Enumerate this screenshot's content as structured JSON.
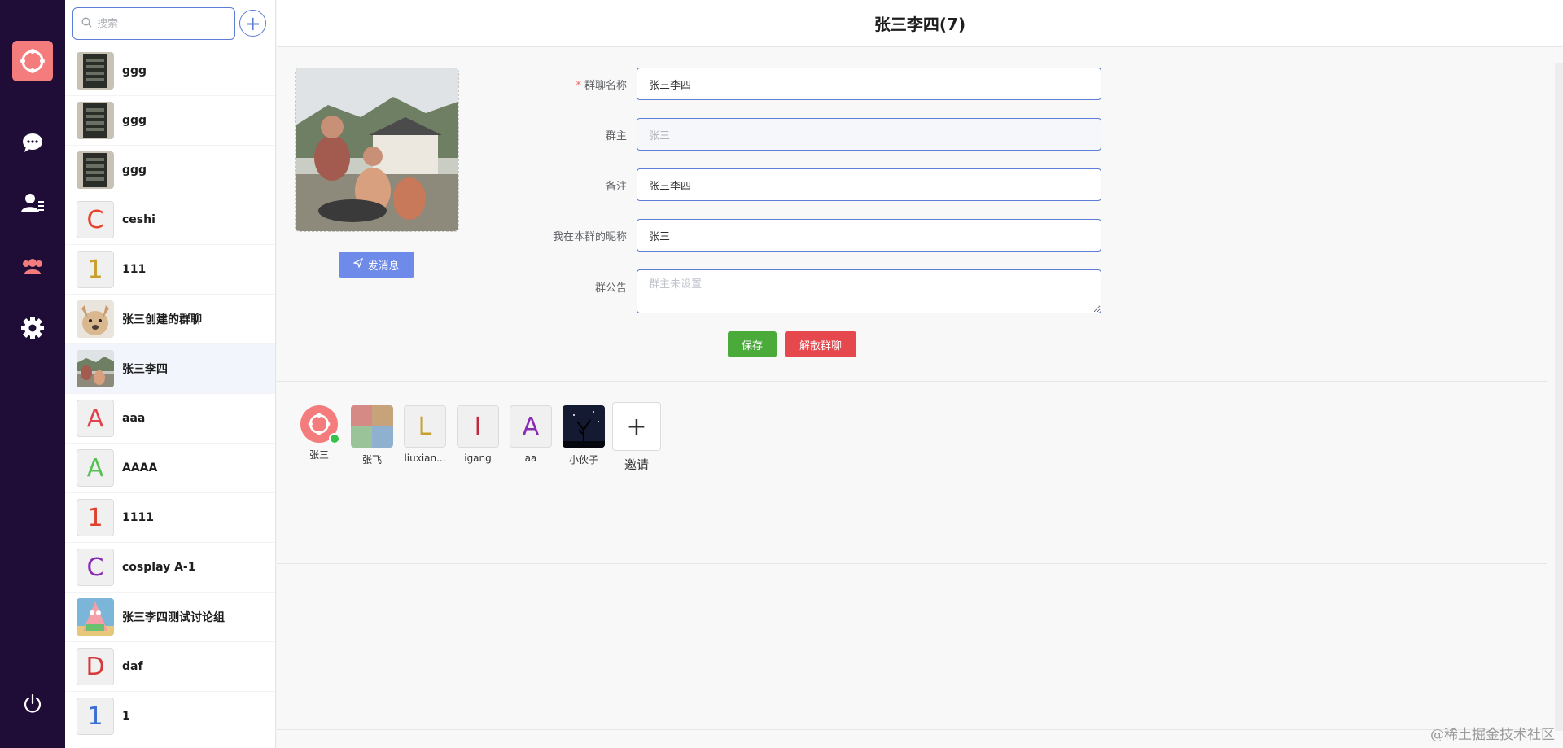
{
  "nav": {
    "logo_icon": "app-logo-icon",
    "items": [
      {
        "name": "chat-icon"
      },
      {
        "name": "contacts-icon"
      },
      {
        "name": "group-icon"
      },
      {
        "name": "settings-icon"
      }
    ],
    "logout_icon": "power-icon",
    "colors": {
      "background": "#1f0d37",
      "logo": "#f47c7c",
      "active": "#f47c7c"
    }
  },
  "search": {
    "placeholder": "搜索"
  },
  "list": {
    "items": [
      {
        "name": "ggg",
        "avatar": "image",
        "letter": ""
      },
      {
        "name": "ggg",
        "avatar": "image",
        "letter": ""
      },
      {
        "name": "ggg",
        "avatar": "image",
        "letter": ""
      },
      {
        "name": "ceshi",
        "avatar": "letter",
        "letter": "C",
        "color": "#e8412c"
      },
      {
        "name": "111",
        "avatar": "letter",
        "letter": "1",
        "color": "#c8a12b"
      },
      {
        "name": "张三创建的群聊",
        "avatar": "image",
        "letter": ""
      },
      {
        "name": "张三李四",
        "avatar": "image",
        "letter": "",
        "active": true
      },
      {
        "name": "aaa",
        "avatar": "letter",
        "letter": "A",
        "color": "#e0424b"
      },
      {
        "name": "AAAA",
        "avatar": "letter",
        "letter": "A",
        "color": "#54c251"
      },
      {
        "name": "1111",
        "avatar": "letter",
        "letter": "1",
        "color": "#e0412c"
      },
      {
        "name": "cosplay A-1",
        "avatar": "letter",
        "letter": "C",
        "color": "#8a2bb5"
      },
      {
        "name": "张三李四测试讨论组",
        "avatar": "image",
        "letter": ""
      },
      {
        "name": "daf",
        "avatar": "letter",
        "letter": "D",
        "color": "#d6393a"
      },
      {
        "name": "1",
        "avatar": "letter",
        "letter": "1",
        "color": "#3a6fd6"
      }
    ]
  },
  "header": {
    "title": "张三李四(7)"
  },
  "send_button": {
    "label": "发消息"
  },
  "form": {
    "group_name": {
      "label": "群聊名称",
      "value": "张三李四"
    },
    "owner": {
      "label": "群主",
      "value": "张三"
    },
    "remark": {
      "label": "备注",
      "value": "张三李四"
    },
    "nickname": {
      "label": "我在本群的昵称",
      "value": "张三"
    },
    "notice": {
      "label": "群公告",
      "placeholder": "群主未设置"
    }
  },
  "actions": {
    "save": "保存",
    "dissolve": "解散群聊"
  },
  "members": [
    {
      "name": "张三",
      "avatar": "logo",
      "online": true
    },
    {
      "name": "张飞",
      "avatar": "image"
    },
    {
      "name": "liuxian...",
      "avatar": "letter",
      "letter": "L",
      "color": "#c8a12b"
    },
    {
      "name": "igang",
      "avatar": "letter",
      "letter": "I",
      "color": "#c0283b"
    },
    {
      "name": "aa",
      "avatar": "letter",
      "letter": "A",
      "color": "#8a2bb5"
    },
    {
      "name": "小伙子",
      "avatar": "image"
    }
  ],
  "invite": {
    "label": "邀请",
    "symbol": "+"
  },
  "watermark": "@稀土掘金技术社区"
}
